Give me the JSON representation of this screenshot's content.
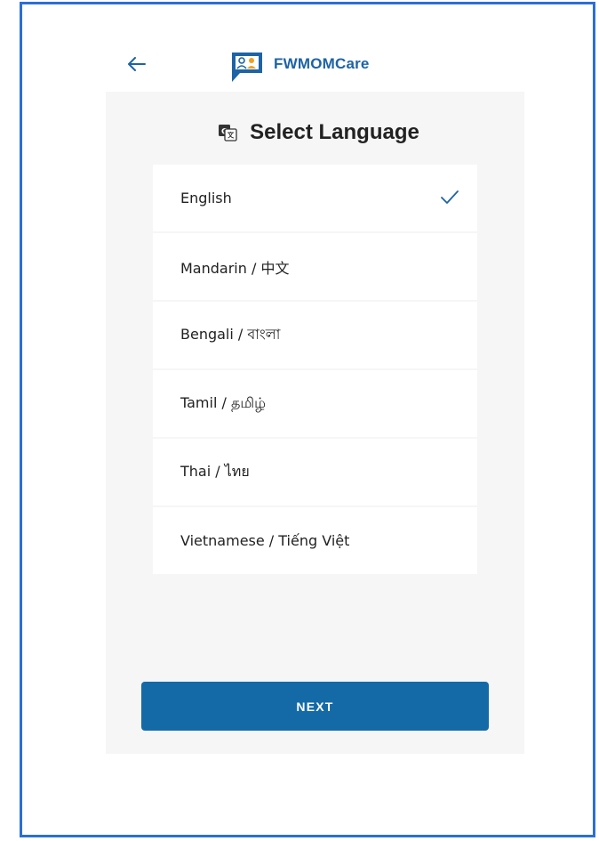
{
  "header": {
    "back_icon": "arrow-left-icon",
    "brand_name": "FWMOMCare",
    "logo_icon": "fwmomcare-logo-icon"
  },
  "colors": {
    "brand": "#1d63a6",
    "button": "#146aa6",
    "panel_bg": "#f6f6f6",
    "frame_border": "#2b6fd6",
    "check": "#1d63a6"
  },
  "language_select": {
    "title": "Select Language",
    "title_icon": "translate-icon",
    "selected_icon": "checkmark-icon",
    "items": [
      {
        "label": "English",
        "selected": true
      },
      {
        "label": "Mandarin / 中文",
        "selected": false
      },
      {
        "label": "Bengali / বাংলা",
        "selected": false
      },
      {
        "label": "Tamil / தமிழ்",
        "selected": false
      },
      {
        "label": "Thai / ไทย",
        "selected": false
      },
      {
        "label": "Vietnamese / Tiếng Việt",
        "selected": false
      }
    ]
  },
  "actions": {
    "next_label": "NEXT"
  }
}
